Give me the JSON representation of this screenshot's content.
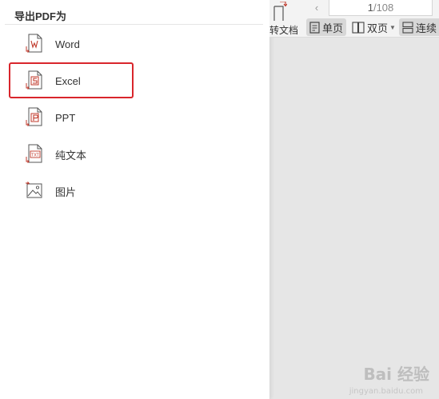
{
  "panel": {
    "title": "导出PDF为",
    "items": [
      {
        "label": "Word",
        "icon": "word-export-icon",
        "highlighted": false
      },
      {
        "label": "Excel",
        "icon": "excel-export-icon",
        "highlighted": true
      },
      {
        "label": "PPT",
        "icon": "ppt-export-icon",
        "highlighted": false
      },
      {
        "label": "纯文本",
        "icon": "txt-export-icon",
        "highlighted": false
      },
      {
        "label": "图片",
        "icon": "image-export-icon",
        "highlighted": false
      }
    ]
  },
  "toolbar": {
    "convert_label": "转文档",
    "page_current": "1",
    "page_total": "/108",
    "single_page_label": "单页",
    "double_page_label": "双页",
    "continuous_label": "连续"
  },
  "watermark": {
    "brand": "Bai 经验",
    "url": "jingyan.baidu.com"
  },
  "colors": {
    "accent_red": "#d9262c",
    "panel_bg": "#ffffff",
    "canvas_bg": "#e6e6e6"
  }
}
